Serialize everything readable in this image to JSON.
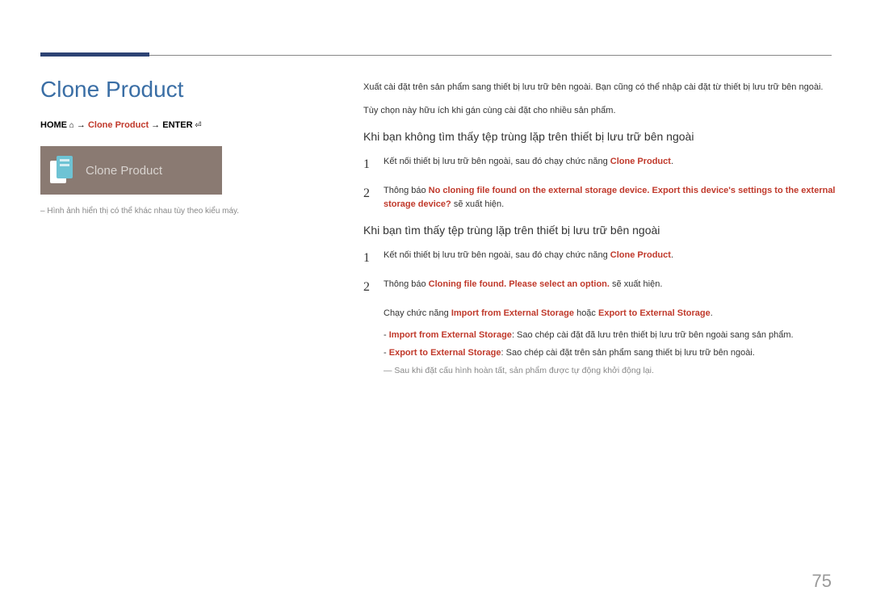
{
  "title": "Clone Product",
  "breadcrumb": {
    "home": "HOME",
    "arrow1": " → ",
    "item": "Clone Product",
    "arrow2": " → ",
    "enter": "ENTER"
  },
  "tile_label": "Clone Product",
  "image_caption": "Hình ảnh hiển thị có thể khác nhau tùy theo kiểu máy.",
  "intro1": "Xuất cài đặt trên sản phẩm sang thiết bị lưu trữ bên ngoài. Bạn cũng có thể nhập cài đặt từ thiết bị lưu trữ bên ngoài.",
  "intro2": "Tùy chọn này hữu ích khi gán cùng cài đặt cho nhiều sản phẩm.",
  "section1": {
    "heading": "Khi bạn không tìm thấy tệp trùng lặp trên thiết bị lưu trữ bên ngoài",
    "step1_pre": "Kết nối thiết bị lưu trữ bên ngoài, sau đó chạy chức năng ",
    "step1_bold": "Clone Product",
    "step1_post": ".",
    "step2_pre": "Thông báo ",
    "step2_bold": "No cloning file found on the external storage device. Export this device's settings to the external storage device?",
    "step2_post": " sẽ xuất hiện."
  },
  "section2": {
    "heading": "Khi bạn tìm thấy tệp trùng lặp trên thiết bị lưu trữ bên ngoài",
    "step1_pre": "Kết nối thiết bị lưu trữ bên ngoài, sau đó chạy chức năng ",
    "step1_bold": "Clone Product",
    "step1_post": ".",
    "step2_pre": "Thông báo ",
    "step2_bold": "Cloning file found. Please select an option.",
    "step2_post": " sẽ xuất hiện.",
    "run_pre": "Chạy chức năng ",
    "run_opt1": "Import from External Storage",
    "run_mid": " hoặc ",
    "run_opt2": "Export to External Storage",
    "run_post": ".",
    "sub1_bold": "Import from External Storage",
    "sub1_text": ": Sao chép cài đặt đã lưu trên thiết bị lưu trữ bên ngoài sang sản phẩm.",
    "sub2_bold": "Export to External Storage",
    "sub2_text": ": Sao chép cài đặt trên sản phẩm sang thiết bị lưu trữ bên ngoài.",
    "footnote": "Sau khi đặt cấu hình hoàn tất, sản phẩm được tự động khởi động lại."
  },
  "page_number": "75"
}
